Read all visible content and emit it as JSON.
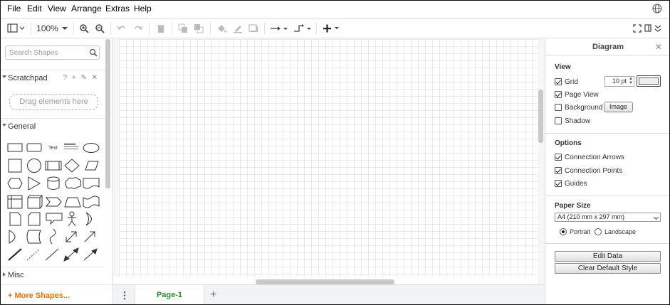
{
  "menubar": {
    "items": [
      "File",
      "Edit",
      "View",
      "Arrange",
      "Extras",
      "Help"
    ]
  },
  "toolbar": {
    "zoom": "100%"
  },
  "sidebar": {
    "search_placeholder": "Search Shapes",
    "scratchpad_label": "Scratchpad",
    "scratchpad_actions": "? + ✎ ✕",
    "dropzone_text": "Drag elements here",
    "general_label": "General",
    "text_shape_label": "Text",
    "misc_label": "Misc",
    "more_shapes": "+ More Shapes..."
  },
  "pages": {
    "tabs": [
      "Page-1"
    ]
  },
  "format_panel": {
    "title": "Diagram",
    "view_heading": "View",
    "grid_label": "Grid",
    "grid_checked": true,
    "grid_size": "10 pt",
    "page_view_label": "Page View",
    "page_view_checked": true,
    "background_label": "Background",
    "background_checked": false,
    "image_button": "Image",
    "shadow_label": "Shadow",
    "shadow_checked": false,
    "options_heading": "Options",
    "connection_arrows_label": "Connection Arrows",
    "connection_points_label": "Connection Points",
    "guides_label": "Guides",
    "paper_size_heading": "Paper Size",
    "paper_size_value": "A4 (210 mm x 297 mm)",
    "portrait_label": "Portrait",
    "landscape_label": "Landscape",
    "orientation": "portrait",
    "edit_data_button": "Edit Data",
    "clear_style_button": "Clear Default Style"
  },
  "colors": {
    "accent_orange": "#e57300",
    "page_tab_green": "#2c8a2c",
    "grid_line": "#e8e8e8"
  }
}
